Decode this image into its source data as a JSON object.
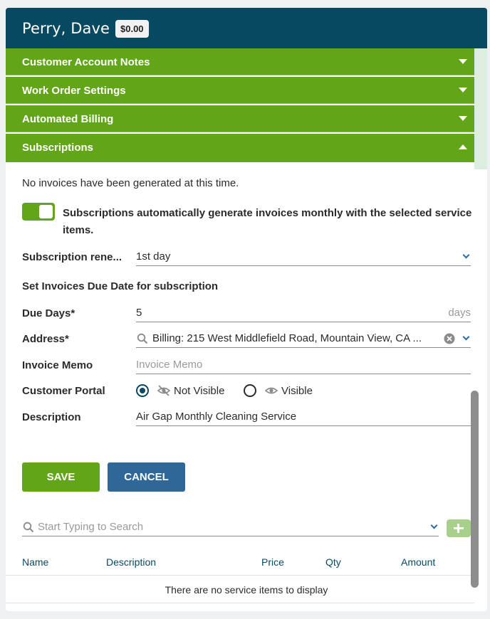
{
  "header": {
    "customer_name": "Perry, Dave",
    "balance": "$0.00"
  },
  "accordion": [
    {
      "label": "Customer Account Notes",
      "state": "collapsed"
    },
    {
      "label": "Work Order Settings",
      "state": "collapsed"
    },
    {
      "label": "Automated Billing",
      "state": "collapsed"
    },
    {
      "label": "Subscriptions",
      "state": "expanded"
    }
  ],
  "subscriptions": {
    "no_invoices_text": "No invoices have been generated at this time.",
    "auto_toggle": {
      "on": true,
      "text": "Subscriptions automatically generate invoices monthly with the selected service items."
    },
    "renewal": {
      "label": "Subscription rene...",
      "value": "1st day"
    },
    "due_date_heading": "Set Invoices Due Date for subscription",
    "due_days": {
      "label": "Due Days*",
      "value": "5",
      "unit": "days"
    },
    "address": {
      "label": "Address*",
      "value": "Billing: 215 West Middlefield Road, Mountain View, CA ..."
    },
    "invoice_memo": {
      "label": "Invoice Memo",
      "placeholder": "Invoice Memo",
      "value": ""
    },
    "customer_portal": {
      "label": "Customer Portal",
      "options": [
        {
          "label": "Not Visible",
          "icon": "eye-off-icon",
          "selected": true
        },
        {
          "label": "Visible",
          "icon": "eye-icon",
          "selected": false
        }
      ]
    },
    "description": {
      "label": "Description",
      "value": "Air Gap Monthly Cleaning Service"
    }
  },
  "actions": {
    "save_label": "SAVE",
    "cancel_label": "CANCEL"
  },
  "service_search": {
    "placeholder": "Start Typing to Search"
  },
  "service_table": {
    "columns": [
      "Name",
      "Description",
      "Price",
      "Qty",
      "Amount"
    ],
    "empty_text": "There are no service items to display"
  },
  "colors": {
    "header": "#074960",
    "accent_green": "#63a518",
    "cancel_blue": "#306799"
  }
}
